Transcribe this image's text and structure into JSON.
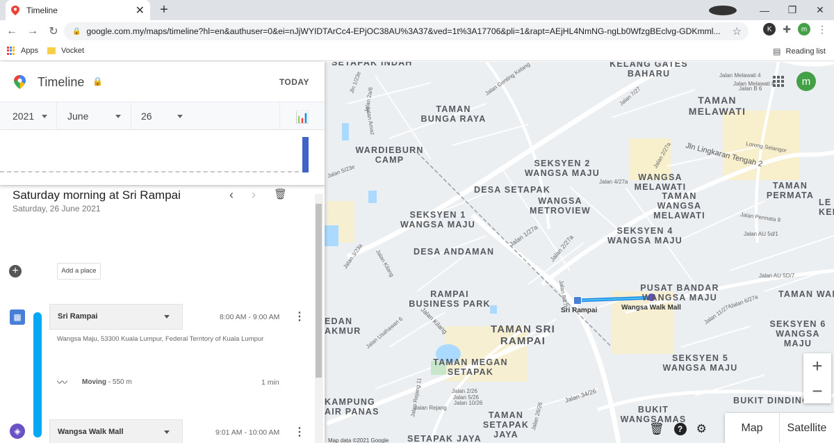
{
  "browser": {
    "tab_title": "Timeline",
    "url": "google.com.my/maps/timeline?hl=en&authuser=0&ei=nJjWYIDTArCc4-EPjOC38AU%3A37&ved=1t%3A17706&pli=1&rapt=AEjHL4NmNG-ngLb0WfzgBEclvg-GDKmml...",
    "bookmarks": [
      "Apps",
      "Vocket"
    ],
    "reading_list": "Reading list",
    "ext_initial_k": "K",
    "profile_initial": "m"
  },
  "timeline": {
    "title": "Timeline",
    "today": "TODAY",
    "year": "2021",
    "month": "June",
    "day": "26",
    "day_heading": "Saturday morning at Sri Rampai",
    "day_subheading": "Saturday, 26 June 2021",
    "add_place": "Add a place",
    "visits": [
      {
        "name": "Sri Rampai",
        "time": "8:00 AM - 9:00 AM",
        "address": "Wangsa Maju, 53300 Kuala Lumpur, Federal Territory of Kuala Lumpur"
      },
      {
        "name": "Wangsa Walk Mall",
        "time": "9:01 AM - 10:00 AM"
      }
    ],
    "movement": {
      "label": "Moving",
      "distance": "- 550 m",
      "duration": "1 min"
    }
  },
  "map": {
    "avatar_initial": "m",
    "map_btn": "Map",
    "satellite_btn": "Satellite",
    "zoom_in": "+",
    "zoom_out": "−",
    "map_data": "Map data ©2021 Google",
    "markers": [
      "Sri Rampai",
      "Wangsa Walk Mall"
    ],
    "areas": [
      "SETAPAK INDAH",
      "KELANG GATES BAHARU",
      "TAMAN MELAWATI",
      "TAMAN BUNGA RAYA",
      "WARDIEBURN CAMP",
      "SEKSYEN 2 WANGSA MAJU",
      "DESA SETAPAK",
      "WANGSA METROVIEW",
      "WANGSA MELAWATI",
      "TAMAN WANGSA MELAWATI",
      "TAMAN PERMATA",
      "SEKSYEN 1 WANGSA MAJU",
      "SEKSYEN 4 WANGSA MAJU",
      "DESA ANDAMAN",
      "PUSAT BANDAR WANGSA MAJU",
      "RAMPAI BUSINESS PARK",
      "TAMAN SRI RAMPAI",
      "TAMAN MEGAN SETAPAK",
      "SEKSYEN 5 WANGSA MAJU",
      "SEKSYEN 6 WANGSA MAJU",
      "TAMAN WANGSA J",
      "BUKIT DINDING",
      "BUKIT WANGSAMAS",
      "TAMAN SETAPAK JAYA",
      "SETAPAK JAYA",
      "KAMPUNG AIR PANAS",
      "EDAN AKMUR",
      "LE KER"
    ],
    "streets": [
      "Jln 1/23e",
      "Jalan Genting Kelang",
      "Jalan 2a/6",
      "Jalan Amaz",
      "Jalan 5/23e",
      "Jalan Melawati 4",
      "Jalan Melawati 8",
      "Jalan B 6",
      "Jalan 7/27",
      "Jln Lingkaran Tengah 2",
      "Jalan 2/27a",
      "Lorong Selangor",
      "Jalan 4/27a",
      "Jalan Permata 9",
      "Jalan 1/27a",
      "Jalan 2/27a",
      "Jalan AU 5d/1",
      "Jalan AU 5D/7",
      "Jalan 3/23a",
      "Jalan Kilang",
      "Jalan 6/27a",
      "Jalan Usahawan 6",
      "Jalan Kilang",
      "Jalan 8/27b",
      "Jalan Rejang 11",
      "Jalan 2/26",
      "Jalan 5/26",
      "Jalan 10/26",
      "Jalan Rejang",
      "Jalan 34/26",
      "Jalan 26/26",
      "Jalan 11/27a"
    ]
  }
}
